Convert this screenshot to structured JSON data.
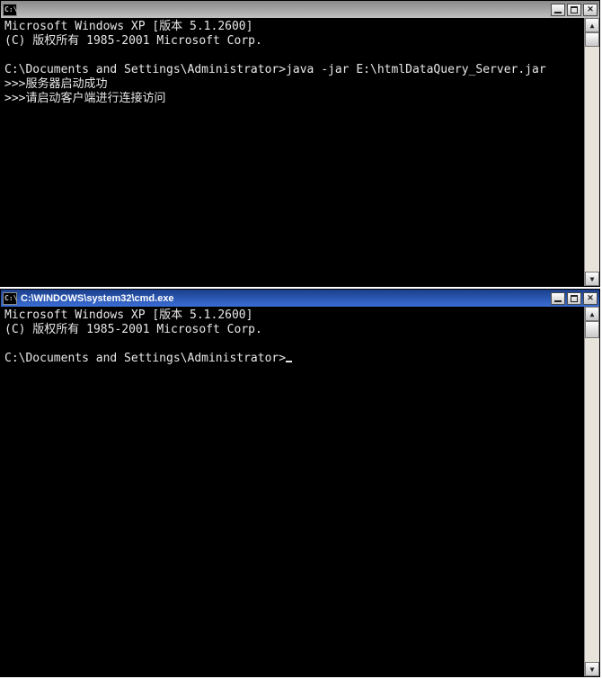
{
  "window1": {
    "title": "",
    "icon_text": "C:\\",
    "lines": [
      "Microsoft Windows XP [版本 5.1.2600]",
      "(C) 版权所有 1985-2001 Microsoft Corp.",
      "",
      "C:\\Documents and Settings\\Administrator>java -jar E:\\htmlDataQuery_Server.jar",
      ">>>服务器启动成功",
      ">>>请启动客户端进行连接访问"
    ],
    "scroll_thumb_pct": 6
  },
  "window2": {
    "title": "C:\\WINDOWS\\system32\\cmd.exe",
    "icon_text": "C:\\",
    "lines": [
      "Microsoft Windows XP [版本 5.1.2600]",
      "(C) 版权所有 1985-2001 Microsoft Corp.",
      "",
      "C:\\Documents and Settings\\Administrator>"
    ],
    "scroll_thumb_pct": 5
  }
}
